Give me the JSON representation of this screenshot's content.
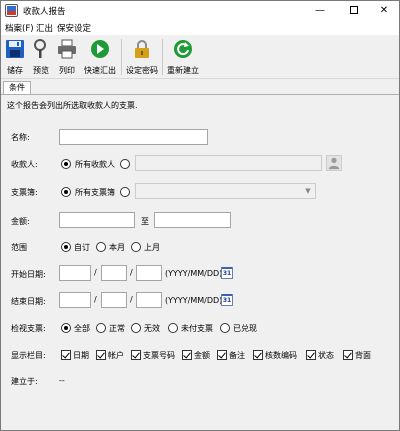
{
  "window": {
    "title": "收款人报告"
  },
  "menu": {
    "items": [
      "档案(F)",
      "汇出",
      "保安设定"
    ]
  },
  "toolbar": {
    "buttons": [
      "储存",
      "预览",
      "列印",
      "快速汇出",
      "设定密码",
      "重新建立"
    ]
  },
  "tabs": {
    "active": "条件"
  },
  "form": {
    "hint": "这个报告会列出所选取收款人的支票.",
    "name_label": "名称:",
    "name_value": "",
    "payee_label": "收款人:",
    "payee_all": "所有收款人",
    "checkbook_label": "支票簿:",
    "checkbook_all": "所有支票簿",
    "amount_label": "金额:",
    "amount_to": "至",
    "amount_from_value": "",
    "amount_to_value": "",
    "range_label": "范围",
    "range_options": [
      "自订",
      "本月",
      "上月"
    ],
    "range_selected": "自订",
    "start_label": "开始日期:",
    "end_label": "结束日期:",
    "date_sep": "/",
    "date_format": "(YYYY/MM/DD)",
    "calendar_text": "31",
    "check_label": "检视支票:",
    "check_options": [
      "全部",
      "正常",
      "无效",
      "未付支票",
      "已兑现"
    ],
    "check_selected": "全部",
    "columns_label": "显示栏目:",
    "columns": [
      "日期",
      "帐户",
      "支票号码",
      "金额",
      "备注",
      "核数编码",
      "状态",
      "背面"
    ],
    "created_label": "建立于:",
    "created_value": "--"
  },
  "colors": {
    "save_icon": "#1f5fbf",
    "export_icon": "#1e9a36",
    "rebuild_icon": "#1e9a36",
    "lock_icon": "#d4a017"
  }
}
